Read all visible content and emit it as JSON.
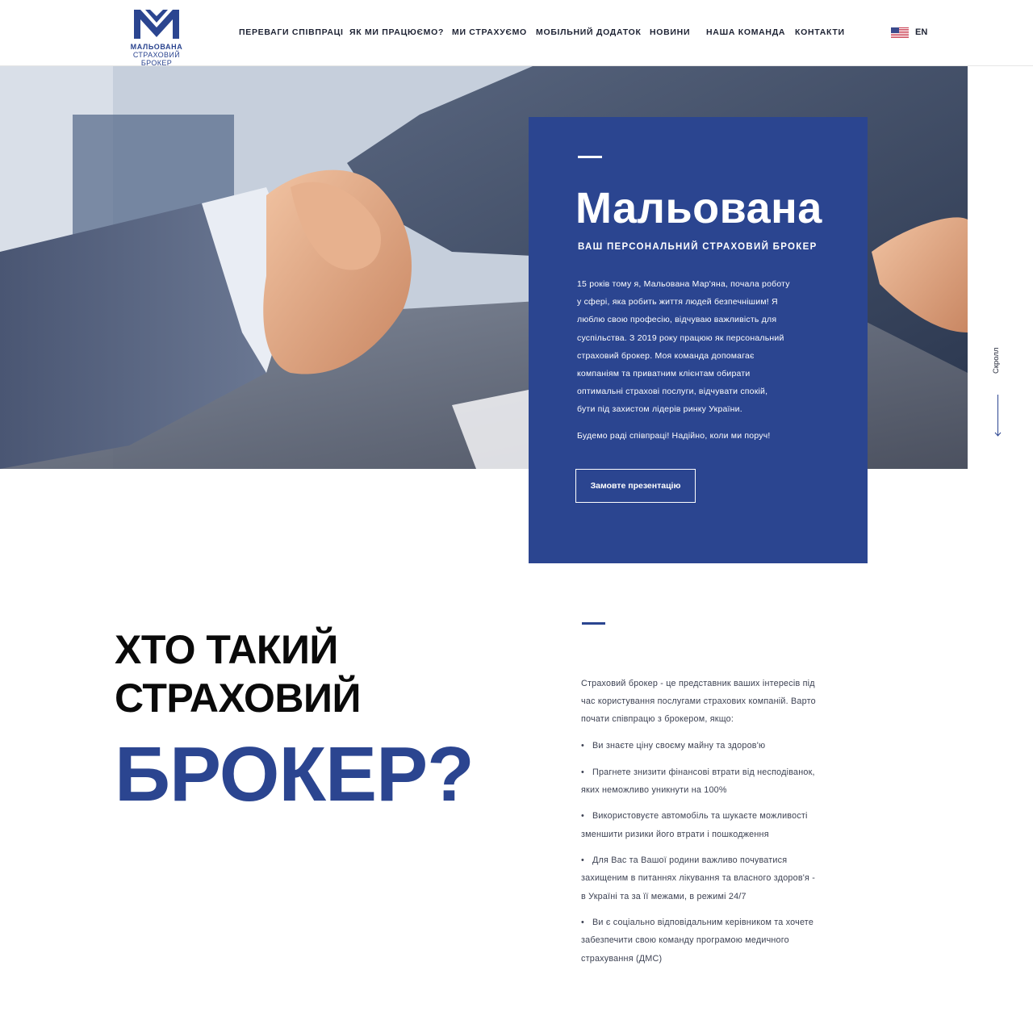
{
  "header": {
    "logo": {
      "name": "МАЛЬОВАНА",
      "sub": "СТРАХОВИЙ БРОКЕР"
    },
    "nav": [
      "ПЕРЕВАГИ СПІВПРАЦІ",
      "ЯК МИ ПРАЦЮЄМО?",
      "МИ СТРАХУЄМО",
      "МОБІЛЬНИЙ ДОДАТОК",
      "НОВИНИ",
      "НАША КОМАНДА",
      "КОНТАКТИ"
    ],
    "language": {
      "label": "EN",
      "flag_icon": "us-flag-icon"
    }
  },
  "hero": {
    "image": "handshake-photo",
    "card": {
      "title": "Мальована",
      "subtitle": "ВАШ ПЕРСОНАЛЬНИЙ СТРАХОВИЙ БРОКЕР",
      "paragraph_lines": [
        "15 років тому я, Мальована Мар'яна, почала роботу",
        "у сфері, яка робить життя людей безпечнішим! Я",
        "люблю свою професію, відчуваю важливість для",
        "суспільства. З 2019 року працюю як персональний",
        "страховий брокер. Моя команда допомагає",
        "компаніям та приватним клієнтам обирати",
        "оптимальні страхові послуги, відчувати спокій,",
        "бути під захистом лідерів ринку України."
      ],
      "closing": "Будемо раді співпраці! Надійно, коли ми поруч!",
      "button": "Замовте презентацію"
    },
    "scroll_label": "Скролл"
  },
  "about": {
    "heading_line1": "ХТО ТАКИЙ",
    "heading_line2": "СТРАХОВИЙ",
    "heading_big": "БРОКЕР?",
    "intro_lines": [
      "Страховий брокер - це представник ваших інтересів під",
      "час користування послугами страхових компаній. Варто",
      "почати співпрацю з брокером, якщо:"
    ],
    "bullets": [
      [
        "Ви знаєте ціну своєму майну та здоров'ю"
      ],
      [
        "Прагнете знизити фінансові втрати від несподіванок,",
        "яких неможливо уникнути на 100%"
      ],
      [
        "Використовуєте автомобіль та шукаєте можливості",
        "зменшити ризики його втрати і пошкодження"
      ],
      [
        "Для Вас та Вашої родини важливо почуватися",
        "захищеним в питаннях лікування та власного здоров'я -",
        "в Україні та за її межами, в режимі 24/7"
      ],
      [
        "Ви є соціально відповідальним керівником та хочете",
        "забезпечити свою команду програмою медичного",
        "страхування (ДМС)"
      ]
    ]
  },
  "colors": {
    "brand": "#2b4590",
    "heading": "#0a0a0a",
    "text": "#3d4253"
  }
}
